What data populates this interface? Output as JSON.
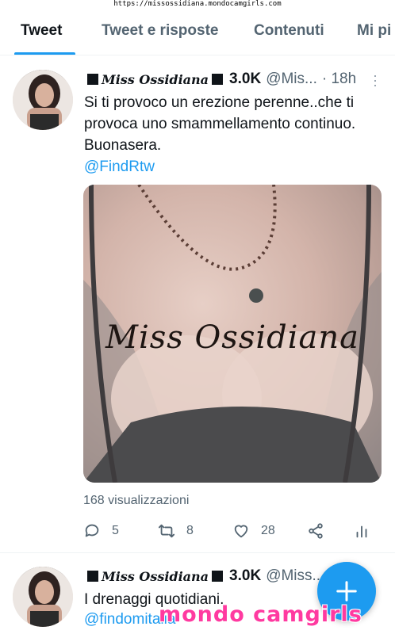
{
  "watermark_top": "https://missossidiana.mondocamgirls.com",
  "tabs": [
    {
      "label": "Tweet",
      "active": true
    },
    {
      "label": "Tweet e risposte",
      "active": false
    },
    {
      "label": "Contenuti",
      "active": false
    },
    {
      "label": "Mi pi",
      "active": false
    }
  ],
  "tweets": [
    {
      "name": "Miss Ossidiana",
      "followers": "3.0K",
      "handle": "@Mis...",
      "time": "· 18h",
      "text": "Si ti provoco un erezione perenne..che ti provoca uno smammellamento continuo. Buonasera.",
      "mention": "@FindRtw",
      "media_caption": "Miss Ossidiana",
      "views": "168 visualizzazioni",
      "actions": {
        "replies": "5",
        "retweets": "8",
        "likes": "28"
      }
    },
    {
      "name": "Miss Ossidiana",
      "followers": "3.0K",
      "handle": "@Miss...",
      "text": "I drenaggi quotidiani.",
      "mention": "@findomitalia"
    }
  ],
  "icons": {
    "reply": "reply-icon",
    "retweet": "retweet-icon",
    "like": "heart-icon",
    "share": "share-icon",
    "analytics": "analytics-icon",
    "compose": "plus-icon",
    "more": "more-vertical-icon"
  },
  "colors": {
    "accent": "#1d9bf0",
    "secondary_text": "#536471",
    "watermark": "#ff3aa0"
  },
  "watermark_bottom": "mondo camgirls"
}
